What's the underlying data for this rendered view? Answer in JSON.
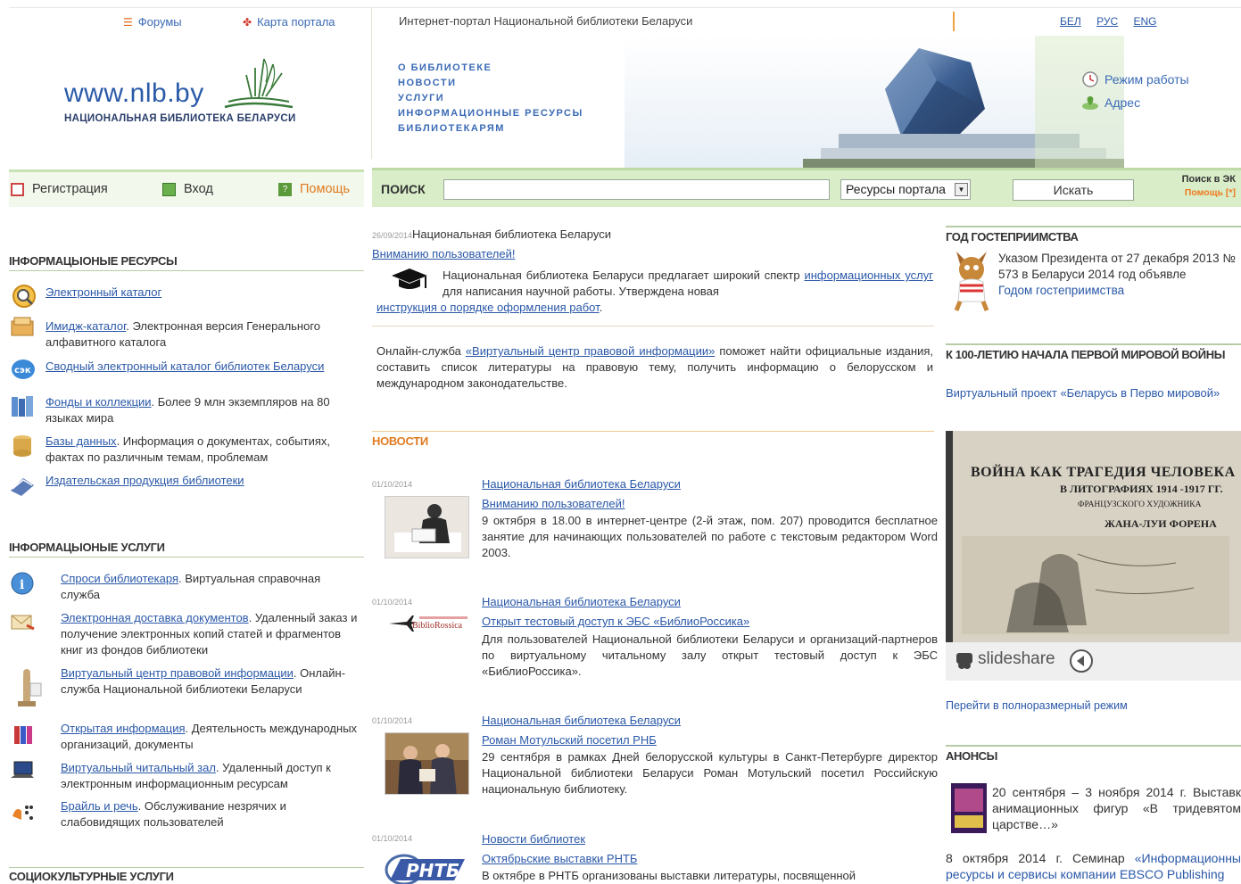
{
  "topnav": {
    "forums": "Форумы",
    "portal_map": "Карта портала",
    "title": "Интернет-портал Национальной библиотеки Беларуси",
    "langs": [
      "БЕЛ",
      "РУС",
      "ENG"
    ]
  },
  "header": {
    "logo_url": "www.nlb.by",
    "logo_sub": "НАЦИОНАЛЬНАЯ БИБЛИОТЕКА БЕЛАРУСИ",
    "menu": [
      "О БИБЛИОТЕКЕ",
      "НОВОСТИ",
      "УСЛУГИ",
      "ИНФОРМАЦИОННЫЕ РЕСУРСЫ",
      "БИБЛИОТЕКАРЯМ"
    ],
    "hours": "Режим работы",
    "address": "Адрес"
  },
  "userbar": {
    "register": "Регистрация",
    "login": "Вход",
    "help": "Помощь"
  },
  "search": {
    "label": "ПОИСК",
    "input_value": "",
    "select_value": "Ресурсы портала",
    "button": "Искать",
    "ek": "Поиск в ЭК",
    "ek_help": "Помощь [*]"
  },
  "left": {
    "resources_title": "ІНФОРМАЦЫОНЫЕ РЕСУРСЫ",
    "resources": [
      {
        "link": "Электронный каталог",
        "text": ""
      },
      {
        "link": "Имидж-каталог",
        "text": ". Электронная версия Генерального алфавитного каталога"
      },
      {
        "link": "Сводный электронный каталог библиотек Беларуси",
        "text": ""
      },
      {
        "link": "Фонды и коллекции",
        "text": ". Более 9 млн экземпляров на 80 языках мира"
      },
      {
        "link": "Базы данных",
        "text": ". Информация о документах, событиях, фактах по различным темам, проблемам"
      },
      {
        "link": "Издательская продукция библиотеки",
        "text": ""
      }
    ],
    "services_title": "ІНФОРМАЦЫОНЫЕ УСЛУГИ",
    "services": [
      {
        "link": "Спроси библиотекаря",
        "text": ". Виртуальная справочная служба"
      },
      {
        "link": "Электронная доставка документов",
        "text": ". Удаленный заказ и получение электронных копий статей и фрагментов книг из фондов библиотеки"
      },
      {
        "link": "Виртуальный центр правовой информации",
        "text": ". Онлайн-служба Национальной библиотеки Беларуси"
      },
      {
        "link": "Открытая информация",
        "text": ". Деятельность международных организаций, документы"
      },
      {
        "link": "Виртуальный читальный зал",
        "text": ". Удаленный доступ к электронным информационным ресурсам"
      },
      {
        "link": "Брайль и речь",
        "text": ". Обслуживание незрячих и слабовидящих пользователей"
      }
    ],
    "socio_title": "СОЦИОКУЛЬТУРНЫЕ УСЛУГИ"
  },
  "center": {
    "notice_date": "26/09/2014",
    "notice_org": "Национальная библиотека Беларуси",
    "notice_title": "Вниманию пользователей!",
    "notice_t1": "Национальная библиотека Беларуси предлагает широкий спектр",
    "notice_link1": "информационных услуг",
    "notice_t2": " для написания научной работы. Утверждена новая",
    "notice_link2": "инструкция о порядке оформления работ",
    "notice_t3": ".",
    "legal_t1": "Онлайн-служба ",
    "legal_link": "«Виртуальный центр правовой информации»",
    "legal_t2": " поможет найти официальные издания, составить список литературы на правовую тему, получить информацию о белорусском и международном законодательстве.",
    "news_title": "НОВОСТИ",
    "news": [
      {
        "date": "01/10/2014",
        "org": "Национальная библиотека Беларуси",
        "title": "Вниманию пользователей!",
        "text": "9 октября в 18.00 в интернет-центре (2-й этаж, пом. 207) проводится бесплатное занятие для начинающих пользователей по работе с текстовым редактором Word 2003."
      },
      {
        "date": "01/10/2014",
        "org": "Национальная библиотека Беларуси",
        "title": "Открыт тестовый доступ к ЭБС «БиблиоРоссика»",
        "text": "Для пользователей Национальной библиотеки Беларуси и организаций-партнеров по виртуальному читальному залу открыт тестовый доступ к ЭБС «БиблиоРоссика»."
      },
      {
        "date": "01/10/2014",
        "org": "Национальная библиотека Беларуси",
        "title": "Роман Мотульский посетил РНБ",
        "text": "29 сентября в рамках Дней белорусской культуры в Санкт-Петербурге директор Национальной библиотеки Беларуси Роман Мотульский посетил Российскую национальную библиотеку."
      },
      {
        "date": "01/10/2014",
        "org": "Новости библиотек",
        "title": "Октябрьские выставки РНТБ",
        "text": "В октябре в РНТБ организованы выставки литературы, посвященной"
      }
    ],
    "biblio_logo": "BiblioRossica"
  },
  "right": {
    "year_title": "ГОД ГОСТЕПРИИМСТВА",
    "year_text": "Указом Президента от 27 декабря 2013 № 573 в Беларуси 2014 год объявле",
    "year_link": "Годом гостеприимства",
    "ww1_title": "К 100-ЛЕТИЮ НАЧАЛА ПЕРВОЙ МИРОВОЙ ВОЙНЫ",
    "ww1_text": "Виртуальный проект «Беларусь в Перво мировой»",
    "slide_title": "ВОЙНА КАК ТРАГЕДИЯ ЧЕЛОВЕКА",
    "slide_sub1": "В ЛИТОГРАФИЯХ 1914 -1917 ГГ.",
    "slide_sub2": "ФРАНЦУЗСКОГО ХУДОЖНИКА",
    "slide_sub3": "ЖАНА-ЛУИ ФОРЕНА",
    "slideshare": "slideshare",
    "fullscreen": "Перейти в полноразмерный режим",
    "announce_title": "АНОНСЫ",
    "announce1": "20 сентября – 3 ноября 2014 г. Выставк анимационных фигур «В тридевятом царстве…»",
    "announce2_t": "8 октября 2014 г. Семинар ",
    "announce2_link": "«Информационны ресурсы и сервисы компании EBSCO Publishing"
  },
  "colors": {
    "link": "#2a58a8",
    "accent": "#e07a20",
    "green_bar": "#d8edc8"
  }
}
